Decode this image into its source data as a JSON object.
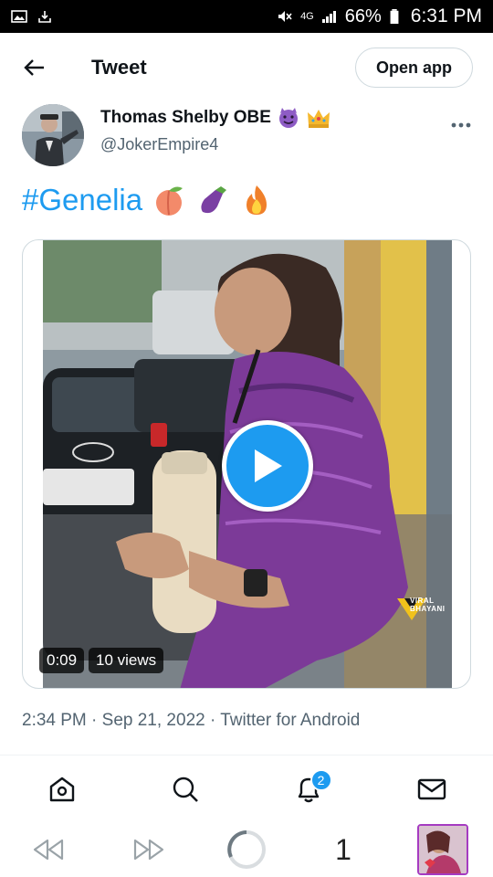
{
  "status_bar": {
    "network": "4G",
    "battery": "66%",
    "time": "6:31 PM"
  },
  "header": {
    "title": "Tweet",
    "open_app_label": "Open app"
  },
  "author": {
    "name": "Thomas Shelby OBE",
    "name_emojis": [
      "smiling-devil-emoji",
      "crown-emoji"
    ],
    "handle": "@JokerEmpire4"
  },
  "tweet": {
    "hashtag": "#Genelia",
    "emojis": [
      "peach-emoji",
      "eggplant-emoji",
      "fire-emoji"
    ]
  },
  "video": {
    "duration": "0:09",
    "views": "10 views",
    "watermark": "VIRAL BHAYANI"
  },
  "meta": {
    "time": "2:34 PM",
    "date": "Sep 21, 2022",
    "source": "Twitter for Android",
    "separator": "·"
  },
  "bottom_nav": {
    "notification_count": "2",
    "items": [
      "home-icon",
      "search-icon",
      "bell-icon",
      "mail-icon"
    ]
  },
  "browser_bar": {
    "tab_count": "1"
  },
  "colors": {
    "accent": "#1d9bf0",
    "text": "#0f1419",
    "secondary": "#536471",
    "border": "#cfd9de"
  }
}
